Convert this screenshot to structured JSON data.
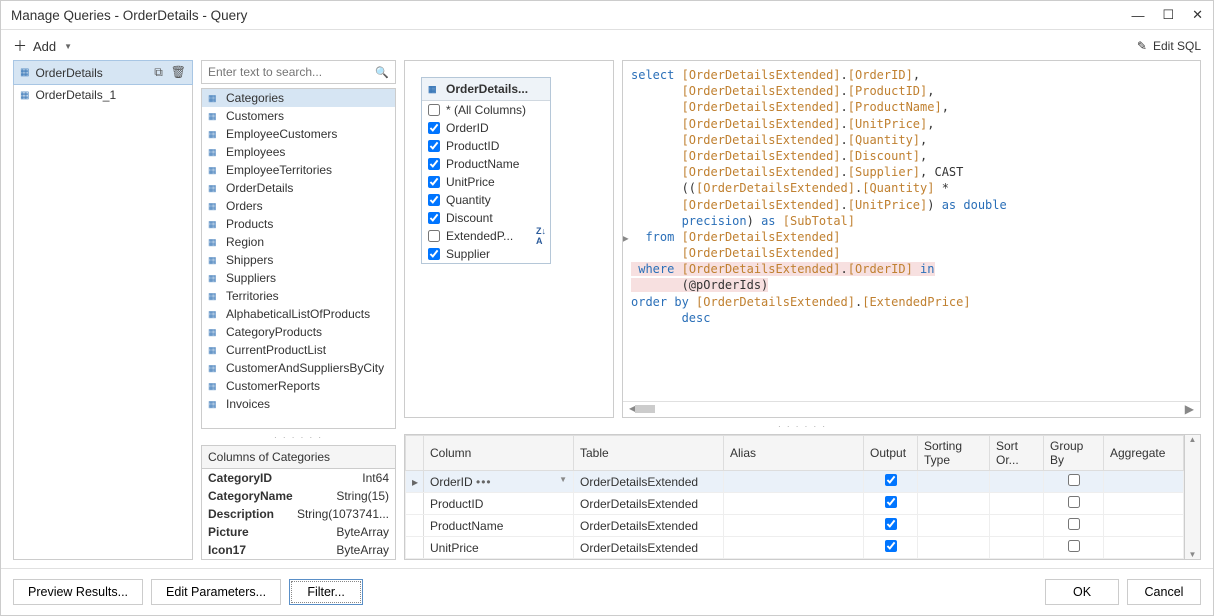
{
  "window": {
    "title": "Manage Queries - OrderDetails - Query"
  },
  "toolbar": {
    "add": "Add",
    "edit_sql": "Edit SQL"
  },
  "queries": [
    {
      "name": "OrderDetails",
      "selected": true
    },
    {
      "name": "OrderDetails_1",
      "selected": false
    }
  ],
  "search": {
    "placeholder": "Enter text to search..."
  },
  "tables": [
    {
      "name": "Categories",
      "selected": true
    },
    {
      "name": "Customers"
    },
    {
      "name": "EmployeeCustomers"
    },
    {
      "name": "Employees"
    },
    {
      "name": "EmployeeTerritories"
    },
    {
      "name": "OrderDetails"
    },
    {
      "name": "Orders"
    },
    {
      "name": "Products"
    },
    {
      "name": "Region"
    },
    {
      "name": "Shippers"
    },
    {
      "name": "Suppliers"
    },
    {
      "name": "Territories"
    },
    {
      "name": "AlphabeticalListOfProducts"
    },
    {
      "name": "CategoryProducts"
    },
    {
      "name": "CurrentProductList"
    },
    {
      "name": "CustomerAndSuppliersByCity"
    },
    {
      "name": "CustomerReports"
    },
    {
      "name": "Invoices"
    }
  ],
  "columns_panel": {
    "header": "Columns of Categories",
    "rows": [
      {
        "name": "CategoryID",
        "type": "Int64"
      },
      {
        "name": "CategoryName",
        "type": "String(15)"
      },
      {
        "name": "Description",
        "type": "String(1073741..."
      },
      {
        "name": "Picture",
        "type": "ByteArray"
      },
      {
        "name": "Icon17",
        "type": "ByteArray"
      }
    ]
  },
  "diagram": {
    "title": "OrderDetails...",
    "fields": [
      {
        "label": "* (All Columns)",
        "checked": false
      },
      {
        "label": "OrderID",
        "checked": true
      },
      {
        "label": "ProductID",
        "checked": true
      },
      {
        "label": "ProductName",
        "checked": true
      },
      {
        "label": "UnitPrice",
        "checked": true
      },
      {
        "label": "Quantity",
        "checked": true
      },
      {
        "label": "Discount",
        "checked": true
      },
      {
        "label": "ExtendedP...",
        "checked": false,
        "sort": "ZA"
      },
      {
        "label": "Supplier",
        "checked": true
      }
    ]
  },
  "sql": {
    "lines": [
      {
        "k": "select",
        "t": " [OrderDetailsExtended].[OrderID],"
      },
      {
        "k": "",
        "t": "       [OrderDetailsExtended].[ProductID],"
      },
      {
        "k": "",
        "t": "       [OrderDetailsExtended].[ProductName],"
      },
      {
        "k": "",
        "t": "       [OrderDetailsExtended].[UnitPrice],"
      },
      {
        "k": "",
        "t": "       [OrderDetailsExtended].[Quantity],"
      },
      {
        "k": "",
        "t": "       [OrderDetailsExtended].[Discount],"
      },
      {
        "k": "",
        "t": "       [OrderDetailsExtended].[Supplier], CAST"
      },
      {
        "k": "",
        "t": "       (([OrderDetailsExtended].[Quantity] *"
      },
      {
        "k": "",
        "t": "       [OrderDetailsExtended].[UnitPrice]) ",
        "k2": "as double"
      },
      {
        "k": "",
        "t": "       ",
        "k2": "precision",
        "t2": ") ",
        "k3": "as",
        "t3": " [SubTotal]"
      },
      {
        "k": "  from",
        "t": " [OrderDetailsExtended]"
      },
      {
        "k": "",
        "t": "       [OrderDetailsExtended]"
      },
      {
        "k": " where",
        "t": " [OrderDetailsExtended].[OrderID] ",
        "k2": "in",
        "hl": true
      },
      {
        "k": "",
        "t": "       (@pOrderIds)",
        "hl": true
      },
      {
        "k": "order by",
        "t": " [OrderDetailsExtended].[ExtendedPrice]"
      },
      {
        "k": "",
        "t": "       ",
        "k2": "desc"
      }
    ]
  },
  "grid": {
    "headers": [
      "Column",
      "Table",
      "Alias",
      "Output",
      "Sorting Type",
      "Sort Or...",
      "Group By",
      "Aggregate"
    ],
    "rows": [
      {
        "column": "OrderID",
        "table": "OrderDetailsExtended",
        "alias": "",
        "output": true,
        "selected": true,
        "dropdown": true
      },
      {
        "column": "ProductID",
        "table": "OrderDetailsExtended",
        "alias": "",
        "output": true
      },
      {
        "column": "ProductName",
        "table": "OrderDetailsExtended",
        "alias": "",
        "output": true
      },
      {
        "column": "UnitPrice",
        "table": "OrderDetailsExtended",
        "alias": "",
        "output": true
      }
    ]
  },
  "footer": {
    "preview": "Preview Results...",
    "edit_params": "Edit Parameters...",
    "filter": "Filter...",
    "ok": "OK",
    "cancel": "Cancel"
  }
}
